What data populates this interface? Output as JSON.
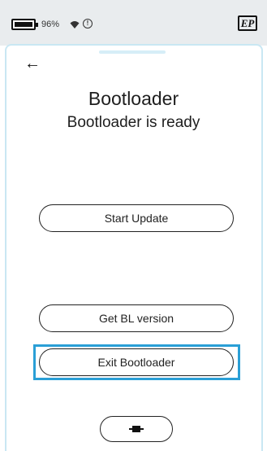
{
  "status_bar": {
    "battery_percent": "96%",
    "battery_icon": "battery-icon",
    "wifi_icon": "wifi-icon",
    "alert_icon": "alert-circle-icon",
    "app_logo_text": "EP"
  },
  "nav": {
    "back_glyph": "←",
    "back_icon": "back-arrow-icon"
  },
  "header": {
    "title": "Bootloader",
    "status": "Bootloader is ready"
  },
  "actions": {
    "start_update_label": "Start Update",
    "get_bl_version_label": "Get BL version",
    "exit_bootloader_label": "Exit Bootloader",
    "connection_icon": "connector-icon"
  },
  "colors": {
    "highlight": "#2a9fd6",
    "panel_border": "#c9e7f3",
    "status_bar_bg": "#e9ecee"
  }
}
